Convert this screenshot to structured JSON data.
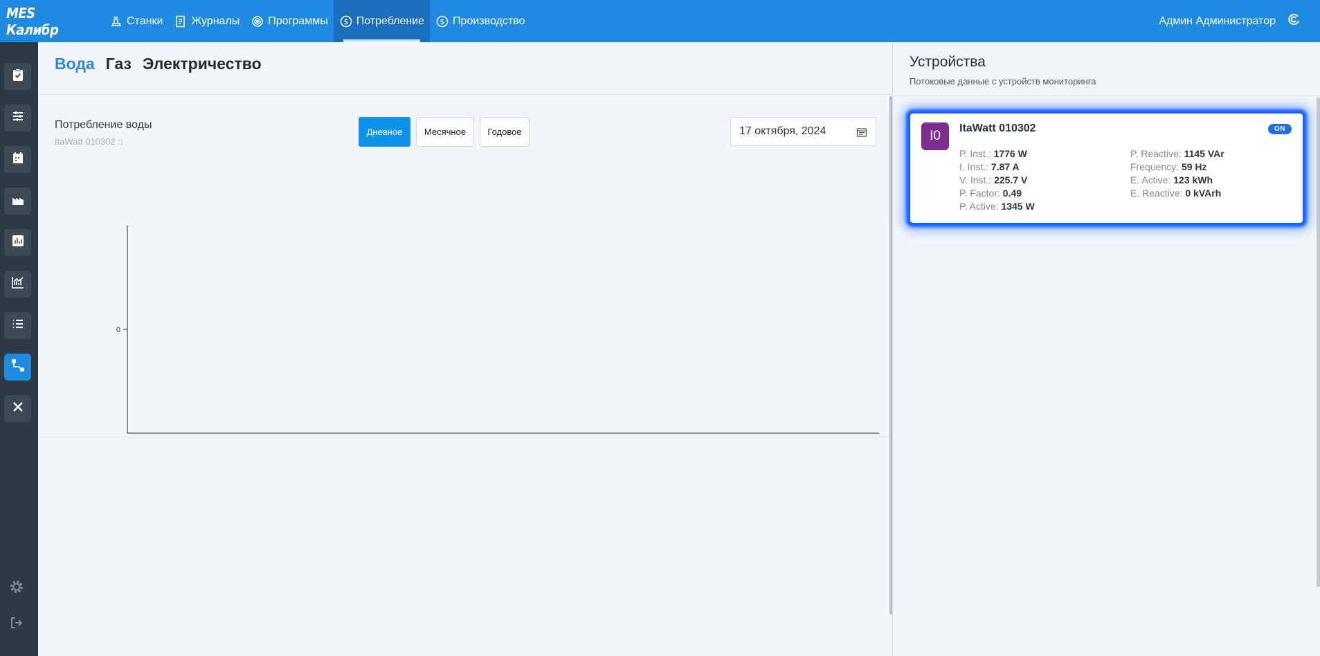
{
  "brand": "MES Калибр",
  "nav": [
    {
      "label": "Станки",
      "icon": "machine-icon"
    },
    {
      "label": "Журналы",
      "icon": "journal-icon"
    },
    {
      "label": "Программы",
      "icon": "program-icon"
    },
    {
      "label": "Потребление",
      "icon": "dollar-circle-icon",
      "active": true
    },
    {
      "label": "Производство",
      "icon": "dollar-circle-icon"
    }
  ],
  "user": {
    "name": "Админ Администратор"
  },
  "tabs": [
    {
      "label": "Вода",
      "active": true
    },
    {
      "label": "Газ"
    },
    {
      "label": "Электричество"
    }
  ],
  "chart": {
    "title": "Потребление воды",
    "subtitle": "ItaWatt 010302 ::",
    "periods": [
      {
        "label": "Дневное",
        "active": true
      },
      {
        "label": "Месячное"
      },
      {
        "label": "Годовое"
      }
    ],
    "date": "17 октября, 2024"
  },
  "chart_data": {
    "type": "line",
    "title": "",
    "xlabel": "",
    "ylabel": "",
    "x": [],
    "series": [],
    "y_ticks": [
      "0"
    ],
    "grid": false
  },
  "devices": {
    "title": "Устройства",
    "subtitle": "Потоковые данные с устройств мониторинга",
    "items": [
      {
        "avatar": "I0",
        "name": "ItaWatt 010302",
        "status": "ON",
        "metrics_left": [
          {
            "label": "P. Inst.:",
            "value": "1776 W"
          },
          {
            "label": "I. Inst.:",
            "value": "7.87 A"
          },
          {
            "label": "V. Inst.:",
            "value": "225.7 V"
          },
          {
            "label": "P. Factor:",
            "value": "0.49"
          },
          {
            "label": "P. Active:",
            "value": "1345 W"
          }
        ],
        "metrics_right": [
          {
            "label": "P. Reactive:",
            "value": "1145 VAr"
          },
          {
            "label": "Frequency:",
            "value": "59 Hz"
          },
          {
            "label": "E. Active:",
            "value": "123 kWh"
          },
          {
            "label": "E. Reactive:",
            "value": "0 kVArh"
          }
        ]
      }
    ]
  },
  "colors": {
    "accent": "#1f8ae2",
    "rail": "#2d3a45",
    "active_tab": "#2f86d9",
    "status_on": "#1f6ee8"
  }
}
